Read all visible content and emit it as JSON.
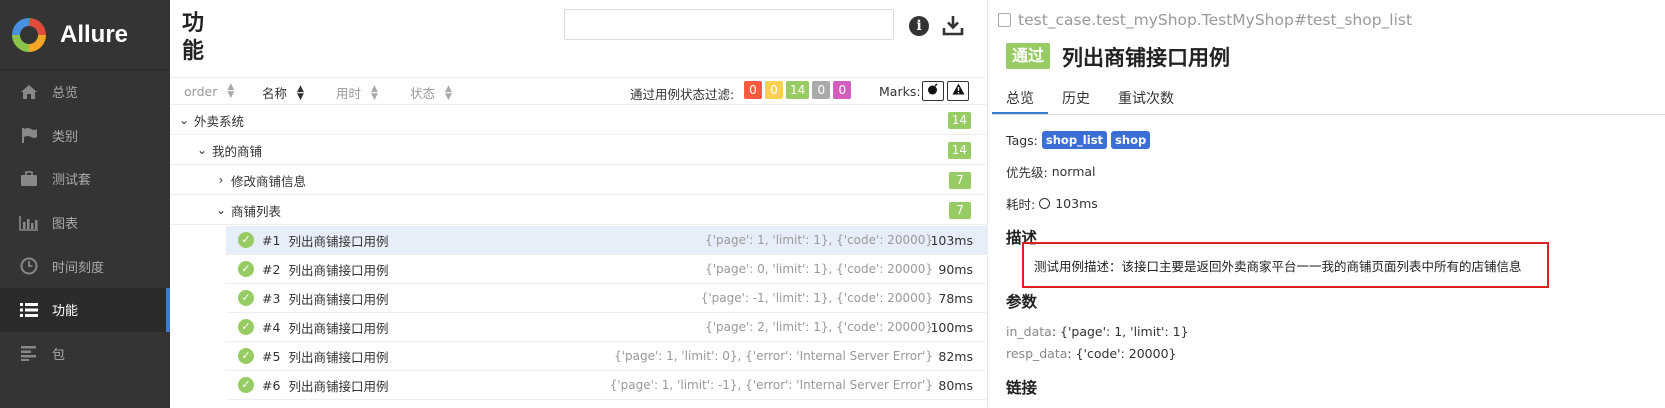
{
  "sidebar": {
    "brand": "Allure",
    "items": [
      {
        "label": "总览",
        "icon": "home-icon"
      },
      {
        "label": "类别",
        "icon": "flag-icon"
      },
      {
        "label": "测试套",
        "icon": "briefcase-icon"
      },
      {
        "label": "图表",
        "icon": "bar-chart-icon"
      },
      {
        "label": "时间刻度",
        "icon": "clock-icon"
      },
      {
        "label": "功能",
        "icon": "list-icon",
        "active": true
      },
      {
        "label": "包",
        "icon": "align-left-icon"
      }
    ]
  },
  "middle": {
    "title": "功能",
    "search_placeholder": "",
    "sort": {
      "order": "order",
      "name": "名称",
      "duration": "用时",
      "status": "状态"
    },
    "filter_label": "通过用例状态过滤:",
    "status_counts": [
      {
        "value": "0",
        "color": "#fd5a3e"
      },
      {
        "value": "0",
        "color": "#ffd050"
      },
      {
        "value": "14",
        "color": "#97cc64"
      },
      {
        "value": "0",
        "color": "#aaaaaa"
      },
      {
        "value": "0",
        "color": "#d35ebe"
      }
    ],
    "marks_label": "Marks:",
    "marks": [
      {
        "icon": "bomb-icon",
        "glyph": "💣"
      },
      {
        "icon": "warning-icon",
        "glyph": "⚠"
      }
    ],
    "tree": [
      {
        "label": "外卖系统",
        "count": "14",
        "expanded": true
      },
      {
        "label": "我的商铺",
        "count": "14",
        "expanded": true
      },
      {
        "label": "修改商铺信息",
        "count": "7",
        "expanded": false
      },
      {
        "label": "商铺列表",
        "count": "7",
        "expanded": true
      }
    ],
    "cases": [
      {
        "num": "#1",
        "name": "列出商铺接口用例",
        "params": "{'page': 1, 'limit': 1}, {'code': 20000}",
        "duration": "103ms",
        "selected": true
      },
      {
        "num": "#2",
        "name": "列出商铺接口用例",
        "params": "{'page': 0, 'limit': 1}, {'code': 20000}",
        "duration": "90ms"
      },
      {
        "num": "#3",
        "name": "列出商铺接口用例",
        "params": "{'page': -1, 'limit': 1}, {'code': 20000}",
        "duration": "78ms"
      },
      {
        "num": "#4",
        "name": "列出商铺接口用例",
        "params": "{'page': 2, 'limit': 1}, {'code': 20000}",
        "duration": "100ms"
      },
      {
        "num": "#5",
        "name": "列出商铺接口用例",
        "params": "{'page': 1, 'limit': 0}, {'error': 'Internal Server Error'}",
        "duration": "82ms"
      },
      {
        "num": "#6",
        "name": "列出商铺接口用例",
        "params": "{'page': 1, 'limit': -1}, {'error': 'Internal Server Error'}",
        "duration": "80ms"
      }
    ]
  },
  "detail": {
    "path": "test_case.test_myShop.TestMyShop#test_shop_list",
    "status": "通过",
    "title": "列出商铺接口用例",
    "tabs": [
      "总览",
      "历史",
      "重试次数"
    ],
    "tags_label": "Tags:",
    "tags": [
      "shop_list",
      "shop"
    ],
    "priority_label": "优先级:",
    "priority": "normal",
    "duration_label": "耗时:",
    "duration": "103ms",
    "description_heading": "描述",
    "description": "测试用例描述：该接口主要是返回外卖商家平台一一我的商铺页面列表中所有的店铺信息",
    "params_heading": "参数",
    "params": [
      {
        "key": "in_data",
        "value": "{'page': 1, 'limit': 1}"
      },
      {
        "key": "resp_data",
        "value": "{'code': 20000}"
      }
    ],
    "links_heading": "链接"
  }
}
